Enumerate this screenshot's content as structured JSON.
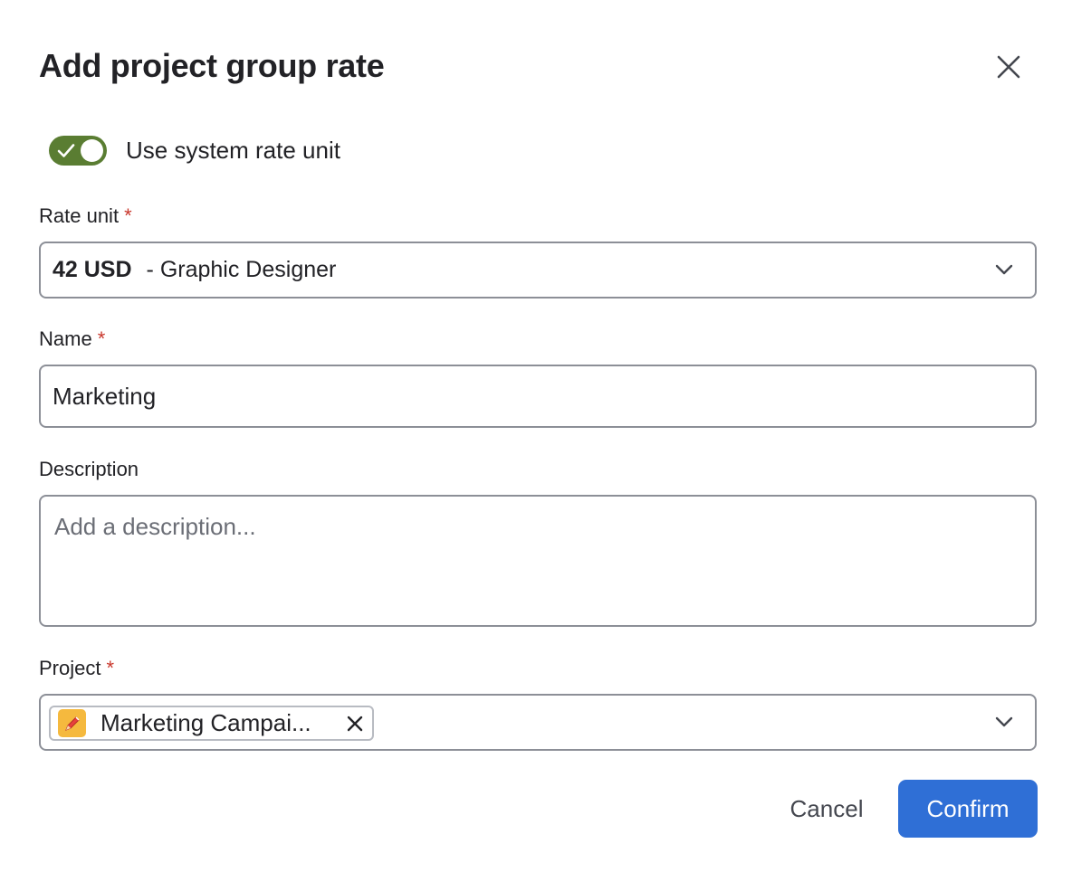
{
  "dialog": {
    "title": "Add project group rate",
    "close_icon": "close-icon"
  },
  "toggle": {
    "label": "Use system rate unit",
    "checked": true,
    "color": "#5a7d32"
  },
  "rate_unit": {
    "label": "Rate unit",
    "required_marker": "*",
    "amount": "42 USD",
    "role": "- Graphic Designer"
  },
  "name": {
    "label": "Name",
    "required_marker": "*",
    "value": "Marketing"
  },
  "description": {
    "label": "Description",
    "placeholder": "Add a description..."
  },
  "project": {
    "label": "Project",
    "required_marker": "*",
    "chip_label": "Marketing Campai...",
    "chip_icon": "pencil-icon",
    "chip_icon_color": "#f5b93e"
  },
  "footer": {
    "cancel_label": "Cancel",
    "confirm_label": "Confirm",
    "accent": "#2f6fd6"
  }
}
